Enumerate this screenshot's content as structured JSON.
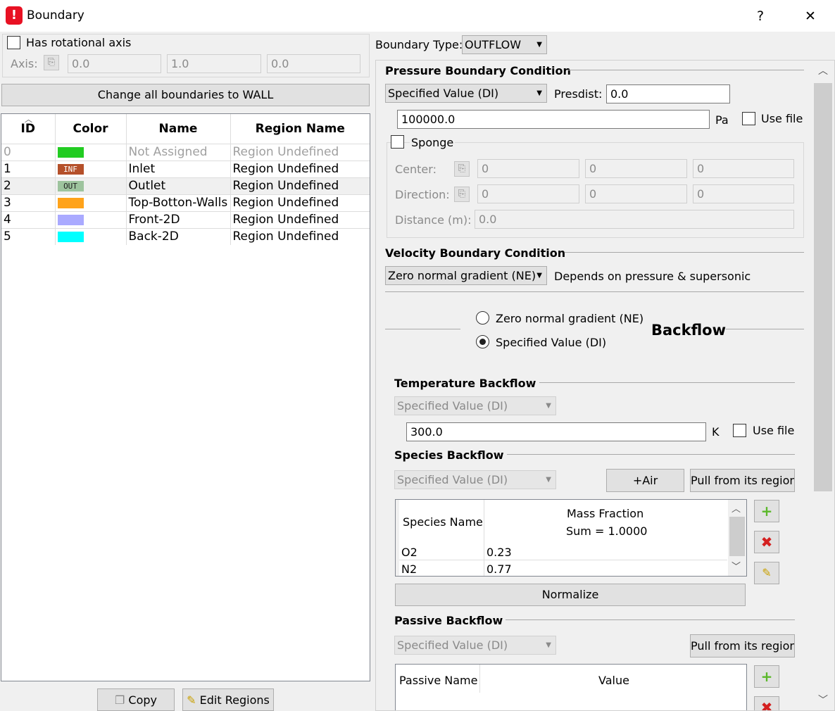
{
  "window": {
    "title": "Boundary",
    "help": "?",
    "close": "✕",
    "app_icon": "!"
  },
  "rotational": {
    "label": "Has rotational axis",
    "axis_label": "Axis:",
    "axis_values": [
      "0.0",
      "1.0",
      "0.0"
    ]
  },
  "change_all_label": "Change all boundaries to WALL",
  "table": {
    "headers": [
      "ID",
      "Color",
      "Name",
      "Region Name"
    ],
    "rows": [
      {
        "id": "0",
        "color": "#22cc22",
        "swatch_text": "",
        "name": "Not Assigned",
        "region": "Region Undefined"
      },
      {
        "id": "1",
        "color": "#b5502a",
        "swatch_text": "INF",
        "name": "Inlet",
        "region": "Region Undefined"
      },
      {
        "id": "2",
        "color": "#9ec49e",
        "swatch_text": "OUT",
        "name": "Outlet",
        "region": "Region Undefined"
      },
      {
        "id": "3",
        "color": "#ffa31a",
        "swatch_text": "",
        "name": "Top-Botton-Walls",
        "region": "Region Undefined"
      },
      {
        "id": "4",
        "color": "#aaaaff",
        "swatch_text": "",
        "name": "Front-2D",
        "region": "Region Undefined"
      },
      {
        "id": "5",
        "color": "#00ffff",
        "swatch_text": "",
        "name": "Back-2D",
        "region": "Region Undefined"
      }
    ]
  },
  "bottom_buttons": {
    "copy": "Copy",
    "edit_regions": "Edit Regions"
  },
  "boundary_type": {
    "label": "Boundary Type:",
    "value": "OUTFLOW"
  },
  "pressure": {
    "title": "Pressure Boundary Condition",
    "mode": "Specified Value (DI)",
    "presdist_label": "Presdist:",
    "presdist_value": "0.0",
    "value": "100000.0",
    "unit": "Pa",
    "use_file": "Use file",
    "sponge": "Sponge",
    "center_label": "Center:",
    "center": [
      "0",
      "0",
      "0"
    ],
    "direction_label": "Direction:",
    "direction": [
      "0",
      "0",
      "0"
    ],
    "distance_label": "Distance (m):",
    "distance": "0.0"
  },
  "velocity": {
    "title": "Velocity Boundary Condition",
    "mode": "Zero normal gradient (NE)",
    "note": "Depends on pressure & supersonic"
  },
  "backflow": {
    "title": "Backflow",
    "option1": "Zero normal gradient (NE)",
    "option2": "Specified Value (DI)"
  },
  "temperature": {
    "title": "Temperature Backflow",
    "mode": "Specified Value (DI)",
    "value": "300.0",
    "unit": "K",
    "use_file": "Use file"
  },
  "species": {
    "title": "Species Backflow",
    "mode": "Specified Value (DI)",
    "air_button": "+Air",
    "pull_button": "Pull from its region",
    "col_name": "Species Name",
    "col_fraction": "Mass Fraction",
    "sum": "Sum = 1.0000",
    "rows": [
      {
        "name": "O2",
        "value": "0.23"
      },
      {
        "name": "N2",
        "value": "0.77"
      }
    ],
    "normalize": "Normalize"
  },
  "passive": {
    "title": "Passive Backflow",
    "mode": "Specified Value (DI)",
    "pull_button": "Pull from its region",
    "col_name": "Passive Name",
    "col_value": "Value"
  },
  "icons": {
    "add": "+",
    "remove": "✖",
    "clear": "broom",
    "paste": "clipboard"
  }
}
